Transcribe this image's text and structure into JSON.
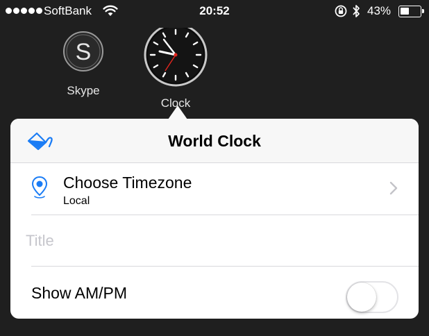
{
  "status_bar": {
    "carrier": "SoftBank",
    "time": "20:52",
    "battery_percent": "43%",
    "battery_level": 0.43
  },
  "home": {
    "apps": [
      {
        "label": "Skype",
        "icon": "skype-icon"
      },
      {
        "label": "Clock",
        "icon": "clock-icon"
      }
    ]
  },
  "popover": {
    "title": "World Clock",
    "header_icon": "paint-bucket-icon",
    "timezone": {
      "label": "Choose Timezone",
      "value": "Local",
      "icon": "location-pin-icon"
    },
    "title_field": {
      "placeholder": "Title",
      "value": ""
    },
    "ampm": {
      "label": "Show AM/PM",
      "enabled": false
    }
  },
  "colors": {
    "accent": "#1a7cf5",
    "background": "#1f1f1f",
    "placeholder": "#c6c6cc"
  }
}
